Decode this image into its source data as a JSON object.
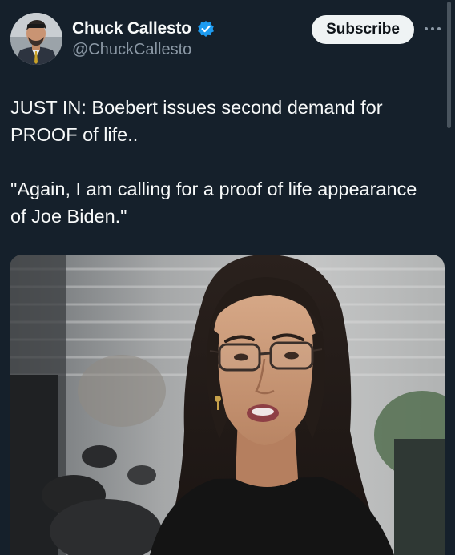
{
  "author": {
    "display_name": "Chuck Callesto",
    "handle": "@ChuckCallesto",
    "verified": true,
    "avatar_icon": "profile-photo"
  },
  "actions": {
    "subscribe_label": "Subscribe",
    "more_icon": "more-horizontal-icon"
  },
  "tweet": {
    "paragraphs": [
      "JUST IN: Boebert issues second demand for\nPROOF of life..",
      "\"Again, I am calling for a proof of life appearance\nof Joe Biden.\""
    ]
  },
  "colors": {
    "background": "#15202b",
    "primary_text": "#f7f9f9",
    "secondary_text": "#8b98a5",
    "verified_badge": "#1d9bf0",
    "subscribe_bg": "#eff3f4"
  }
}
